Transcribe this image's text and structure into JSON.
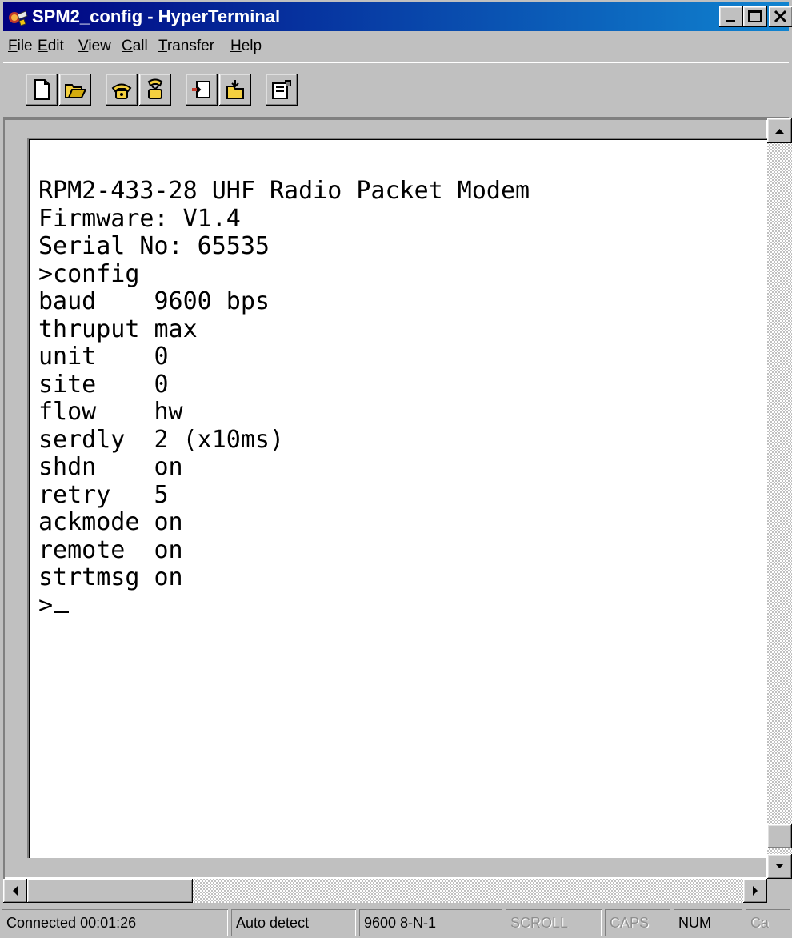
{
  "window": {
    "title": "SPM2_config - HyperTerminal",
    "icon": "phone-icon",
    "controls": [
      "minimize-icon",
      "maximize-icon",
      "close-icon"
    ]
  },
  "menu": {
    "items": [
      "File",
      "Edit",
      "View",
      "Call",
      "Transfer",
      "Help"
    ]
  },
  "toolbar": {
    "buttons": [
      "new-connection-icon",
      "open-icon",
      "connect-icon",
      "disconnect-icon",
      "send-icon",
      "receive-icon",
      "properties-icon"
    ]
  },
  "terminal": {
    "lines": [
      "RPM2-433-28 UHF Radio Packet Modem",
      "Firmware: V1.4",
      "Serial No: 65535",
      ">config",
      "baud    9600 bps",
      "thruput max",
      "unit    0",
      "site    0",
      "flow    hw",
      "serdly  2 (x10ms)",
      "shdn    on",
      "retry   5",
      "ackmode on",
      "remote  on",
      "strtmsg on",
      ">"
    ]
  },
  "statusbar": {
    "connection": "Connected 00:01:26",
    "emulation": "Auto detect",
    "port_settings": "9600 8-N-1",
    "scroll": "SCROLL",
    "caps": "CAPS",
    "num": "NUM",
    "capture": "Ca"
  }
}
